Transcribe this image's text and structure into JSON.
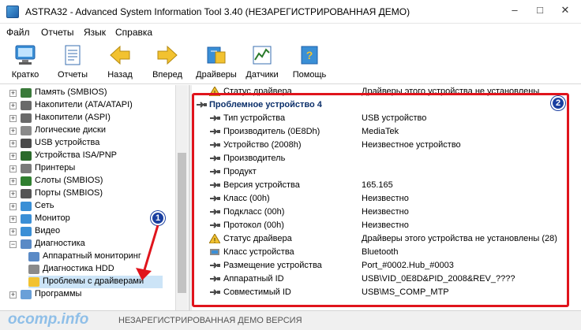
{
  "window": {
    "title": "ASTRA32 - Advanced System Information Tool 3.40 (НЕЗАРЕГИСТРИРОВАННАЯ ДЕМО)",
    "minimize": "–",
    "maximize": "□",
    "close": "✕"
  },
  "menu": [
    "Файл",
    "Отчеты",
    "Язык",
    "Справка"
  ],
  "toolbar": [
    {
      "label": "Кратко",
      "icon": "monitor-icon"
    },
    {
      "label": "Отчеты",
      "icon": "report-icon"
    },
    {
      "label": "Назад",
      "icon": "back-arrow-icon"
    },
    {
      "label": "Вперед",
      "icon": "forward-arrow-icon"
    },
    {
      "label": "Драйверы",
      "icon": "drivers-icon"
    },
    {
      "label": "Датчики",
      "icon": "sensors-icon"
    },
    {
      "label": "Помощь",
      "icon": "help-icon"
    }
  ],
  "tree": [
    {
      "label": "Память (SMBIOS)",
      "icon": "memory-icon",
      "exp": "+"
    },
    {
      "label": "Накопители (ATA/ATAPI)",
      "icon": "drive-icon",
      "exp": "+"
    },
    {
      "label": "Накопители (ASPI)",
      "icon": "drive-icon",
      "exp": "+"
    },
    {
      "label": "Логические диски",
      "icon": "disk-icon",
      "exp": "+"
    },
    {
      "label": "USB устройства",
      "icon": "usb-icon",
      "exp": "+"
    },
    {
      "label": "Устройства ISA/PNP",
      "icon": "chip-icon",
      "exp": "+"
    },
    {
      "label": "Принтеры",
      "icon": "printer-icon",
      "exp": "+"
    },
    {
      "label": "Слоты (SMBIOS)",
      "icon": "slot-icon",
      "exp": "+"
    },
    {
      "label": "Порты (SMBIOS)",
      "icon": "port-icon",
      "exp": "+"
    },
    {
      "label": "Сеть",
      "icon": "network-icon",
      "exp": "+"
    },
    {
      "label": "Монитор",
      "icon": "monitor-icon",
      "exp": "+"
    },
    {
      "label": "Видео",
      "icon": "video-icon",
      "exp": "+"
    },
    {
      "label": "Диагностика",
      "icon": "diagnostics-icon",
      "exp": "−"
    },
    {
      "label": "Аппаратный мониторинг",
      "icon": "sensor-icon",
      "exp": "",
      "indent": true
    },
    {
      "label": "Диагностика HDD",
      "icon": "hdd-icon",
      "exp": "",
      "indent": true
    },
    {
      "label": "Проблемы с драйверами",
      "icon": "driver-problem-icon",
      "exp": "",
      "indent": true,
      "selected": true
    },
    {
      "label": "Программы",
      "icon": "programs-icon",
      "exp": "+"
    }
  ],
  "details": {
    "top_row": {
      "name": "Статус драйвера",
      "value": "Драйверы этого устройства не установлены"
    },
    "header": "Проблемное устройство 4",
    "rows": [
      {
        "name": "Тип устройства",
        "value": "USB устройство",
        "icon": "usb-icon"
      },
      {
        "name": "Производитель (0E8Dh)",
        "value": "MediaTek",
        "icon": "usb-icon"
      },
      {
        "name": "Устройство (2008h)",
        "value": "Неизвестное устройство",
        "icon": "usb-icon"
      },
      {
        "name": "Производитель",
        "value": "",
        "icon": "usb-icon"
      },
      {
        "name": "Продукт",
        "value": "",
        "icon": "usb-icon"
      },
      {
        "name": "Версия устройства",
        "value": "165.165",
        "icon": "usb-icon"
      },
      {
        "name": "Класс (00h)",
        "value": "Неизвестно",
        "icon": "usb-icon"
      },
      {
        "name": "Подкласс (00h)",
        "value": "Неизвестно",
        "icon": "usb-icon"
      },
      {
        "name": "Протокол (00h)",
        "value": "Неизвестно",
        "icon": "usb-icon"
      },
      {
        "name": "Статус драйвера",
        "value": "Драйверы этого устройства не установлены (28)",
        "icon": "warning-icon"
      },
      {
        "name": "Класс устройства",
        "value": "Bluetooth",
        "icon": "device-class-icon"
      },
      {
        "name": "Размещение устройства",
        "value": "Port_#0002.Hub_#0003",
        "icon": "usb-icon"
      },
      {
        "name": "Аппаратный ID",
        "value": "USB\\VID_0E8D&PID_2008&REV_????",
        "icon": "usb-icon"
      },
      {
        "name": "Совместимый ID",
        "value": "USB\\MS_COMP_MTP",
        "icon": "usb-icon"
      }
    ]
  },
  "annotations": {
    "badge1": "1",
    "badge2": "2"
  },
  "status": {
    "text": "НЕЗАРЕГИСТРИРОВАННАЯ ДЕМО ВЕРСИЯ",
    "watermark": "ocomp.info"
  },
  "colors": {
    "highlight": "#e0141c",
    "badge": "#1a3fa0",
    "selection": "#cce4f7"
  }
}
